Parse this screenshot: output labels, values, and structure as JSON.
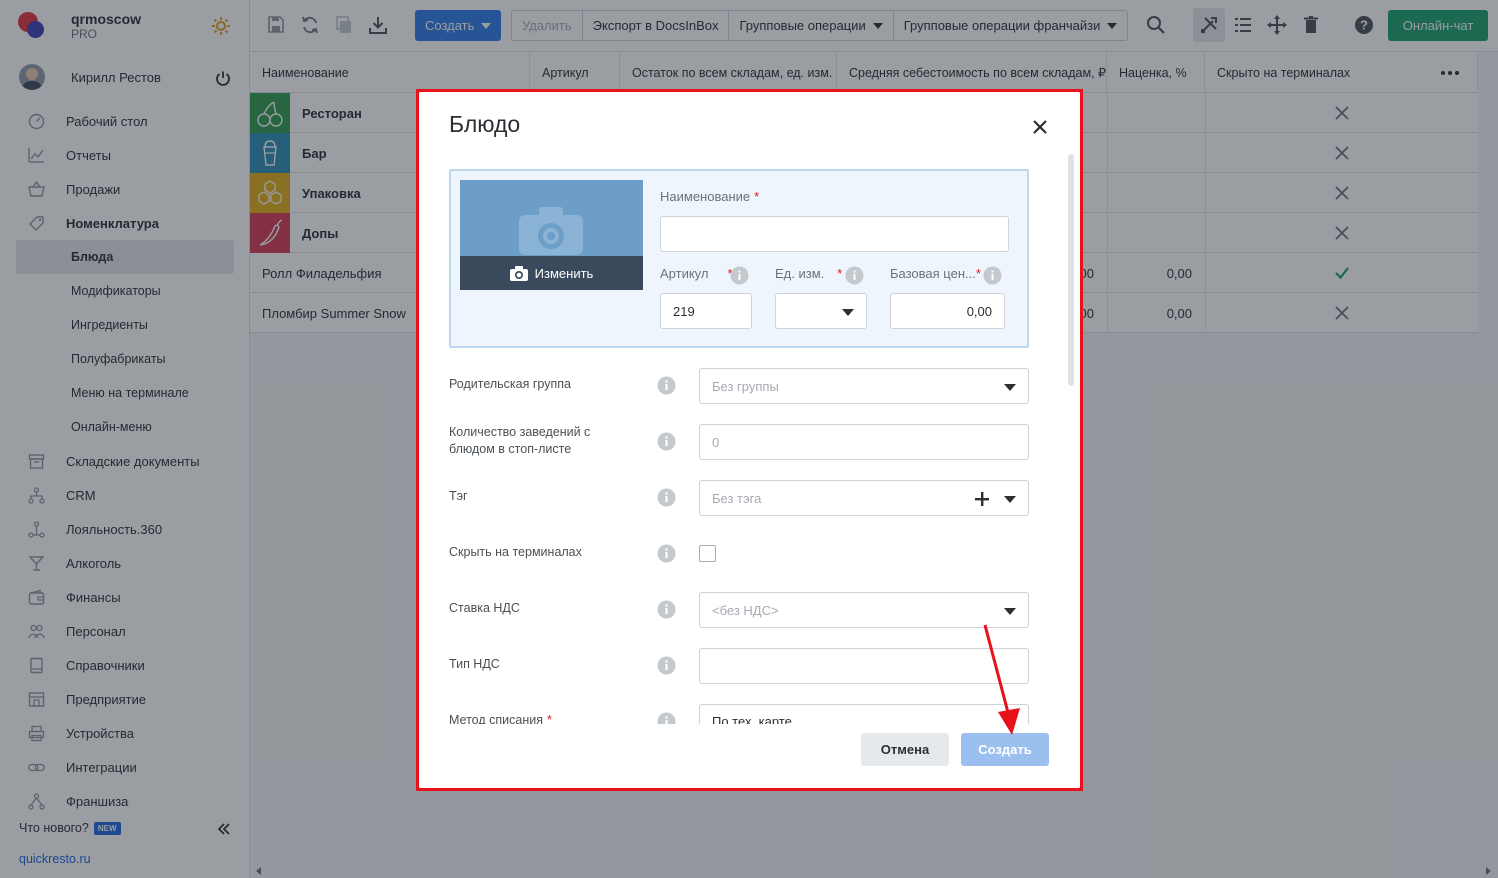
{
  "brand": {
    "name": "qrmoscow",
    "plan": "PRO"
  },
  "user": {
    "name": "Кирилл Рестов"
  },
  "nav": {
    "items": [
      {
        "label": "Рабочий стол",
        "icon": "dashboard-icon"
      },
      {
        "label": "Отчеты",
        "icon": "chart-icon"
      },
      {
        "label": "Продажи",
        "icon": "basket-icon"
      },
      {
        "label": "Номенклатура",
        "icon": "tag-icon"
      }
    ],
    "sub_items": [
      {
        "label": "Блюда"
      },
      {
        "label": "Модификаторы"
      },
      {
        "label": "Ингредиенты"
      },
      {
        "label": "Полуфабрикаты"
      },
      {
        "label": "Меню на терминале"
      },
      {
        "label": "Онлайн-меню"
      }
    ],
    "items_after": [
      {
        "label": "Складские документы",
        "icon": "warehouse-icon"
      },
      {
        "label": "CRM",
        "icon": "crm-icon"
      },
      {
        "label": "Лояльность.360",
        "icon": "loyalty-icon"
      },
      {
        "label": "Алкоголь",
        "icon": "glass-icon"
      },
      {
        "label": "Финансы",
        "icon": "wallet-icon"
      },
      {
        "label": "Персонал",
        "icon": "people-icon"
      },
      {
        "label": "Справочники",
        "icon": "book-icon"
      },
      {
        "label": "Предприятие",
        "icon": "store-icon"
      },
      {
        "label": "Устройства",
        "icon": "printer-icon"
      },
      {
        "label": "Интеграции",
        "icon": "link-icon"
      },
      {
        "label": "Франшиза",
        "icon": "franchise-icon"
      }
    ],
    "whats_new": "Что нового?",
    "new_badge": "NEW",
    "site_link": "quickresto.ru"
  },
  "toolbar": {
    "create_label": "Создать",
    "delete_label": "Удалить",
    "export_label": "Экспорт в DocsInBox",
    "group_ops_label": "Групповые операции",
    "group_ops_franchise_label": "Групповые операции франчайзи",
    "chat_label": "Онлайн-чат"
  },
  "table": {
    "columns": [
      "Наименование",
      "Артикул",
      "Остаток по всем складам, ед. изм.",
      "Средняя себестоимость по всем складам, ₽",
      "Наценка, %",
      "Скрыто на терминалах"
    ],
    "categories": [
      {
        "name": "Ресторан",
        "color": "#2e9b4e",
        "icon": "cherry-icon",
        "hidden": true
      },
      {
        "name": "Бар",
        "color": "#2a8fb5",
        "icon": "cup-icon",
        "hidden": true
      },
      {
        "name": "Упаковка",
        "color": "#e0ad18",
        "icon": "honeycomb-icon",
        "hidden": true
      },
      {
        "name": "Допы",
        "color": "#d63a52",
        "icon": "pepper-icon",
        "hidden": true
      }
    ],
    "rows": [
      {
        "name": "Ролл Филадельфия",
        "cost_partial": "00",
        "markup": "0,00",
        "hidden": false
      },
      {
        "name": "Пломбир Summer Snow",
        "cost_partial": "00",
        "markup": "0,00",
        "hidden": true
      }
    ]
  },
  "modal": {
    "title": "Блюдо",
    "photo_change_label": "Изменить",
    "name_label": "Наименование",
    "name_value": "",
    "article_label": "Артикул",
    "article_value": "219",
    "unit_label": "Ед. изм.",
    "unit_value": "",
    "base_price_label": "Базовая цен...",
    "base_price_value": "0,00",
    "fields": {
      "parent_group": {
        "label": "Родительская группа",
        "value": "Без группы"
      },
      "stoplist_count": {
        "label": "Количество заведений с блюдом в стоп-листе",
        "value": "0"
      },
      "tag": {
        "label": "Тэг",
        "value": "Без тэга"
      },
      "hide_terminals": {
        "label": "Скрыть на терминалах",
        "checked": false
      },
      "vat_rate": {
        "label": "Ставка НДС",
        "value": "<без НДС>"
      },
      "vat_type": {
        "label": "Тип НДС",
        "value": ""
      },
      "writeoff_method": {
        "label": "Метод списания",
        "value": "По тех. карте"
      }
    },
    "cancel_label": "Отмена",
    "create_label": "Создать"
  },
  "colors": {
    "primary": "#2d7be5",
    "chat": "#17a06b",
    "annotation": "#e8121b",
    "check": "#17a06b"
  }
}
